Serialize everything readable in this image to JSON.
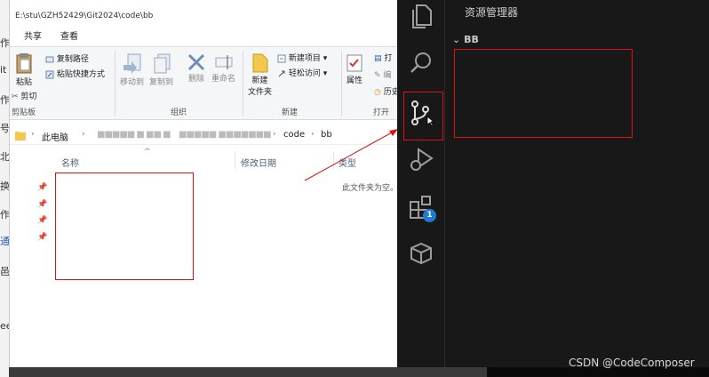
{
  "explorer": {
    "path": "E:\\stu\\GZH52429\\Git2024\\code\\bb",
    "tabs": [
      "共享",
      "查看"
    ],
    "ribbon": {
      "pin_label": "粘贴",
      "copy_path": "复制路径",
      "paste_shortcut": "粘贴快捷方式",
      "cut": "剪切",
      "clipboard_group": "剪贴板",
      "move_to": "移动到",
      "copy_to": "复制到",
      "delete": "删除",
      "rename": "重命名",
      "organize_group": "组织",
      "new_folder_l1": "新建",
      "new_folder_l2": "文件夹",
      "new_item": "新建项目",
      "easy_access": "轻松访问",
      "new_group": "新建",
      "properties": "属性",
      "open_partial": "打",
      "edit_partial": "编",
      "history_partial": "历史",
      "open_group": "打开"
    },
    "address": {
      "this_pc": "此电脑",
      "blurred1": "■■■■■ ■ ■■ ■",
      "blurred2": "■■■■■ ■■■■■■■",
      "code": "code",
      "bb": "bb"
    },
    "columns": {
      "name": "名称",
      "modified": "修改日期",
      "type": "类型"
    },
    "empty_message": "此文件夹为空。"
  },
  "left_sliver": [
    "作",
    "it",
    "作",
    "号",
    "北",
    "换",
    "作",
    "通",
    "邑",
    "ee"
  ],
  "vscode": {
    "sidebar_title": "资源管理器",
    "section": "BB",
    "extensions_badge": "1"
  },
  "watermark": "CSDN @CodeComposer"
}
